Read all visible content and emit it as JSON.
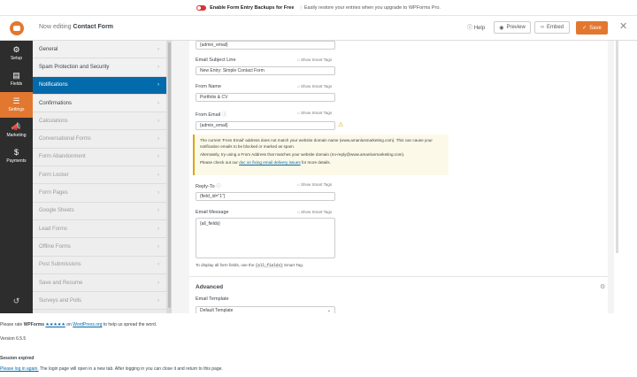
{
  "banner": {
    "label": "Enable Form Entry Backups for Free",
    "separator": "|",
    "text": "Easily restore your entries when you upgrade to WPForms Pro."
  },
  "header": {
    "editing_prefix": "Now editing",
    "form_name": "Contact Form",
    "help": "Help",
    "preview": "Preview",
    "embed": "Embed",
    "save": "Save",
    "close": "✕"
  },
  "leftnav": [
    {
      "label": "Setup",
      "icon": "⚙"
    },
    {
      "label": "Fields",
      "icon": "▤"
    },
    {
      "label": "Settings",
      "icon": "☰"
    },
    {
      "label": "Marketing",
      "icon": "📣"
    },
    {
      "label": "Payments",
      "icon": "$"
    }
  ],
  "undo_icon": "↺",
  "panel": {
    "items": [
      {
        "label": "General",
        "state": "normal"
      },
      {
        "label": "Spam Protection and Security",
        "state": "normal"
      },
      {
        "label": "Notifications",
        "state": "active"
      },
      {
        "label": "Confirmations",
        "state": "normal"
      },
      {
        "label": "Calculations",
        "state": "dim"
      },
      {
        "label": "Conversational Forms",
        "state": "dim"
      },
      {
        "label": "Form Abandonment",
        "state": "dim"
      },
      {
        "label": "Form Locker",
        "state": "dim"
      },
      {
        "label": "Form Pages",
        "state": "dim"
      },
      {
        "label": "Google Sheets",
        "state": "dim"
      },
      {
        "label": "Lead Forms",
        "state": "dim"
      },
      {
        "label": "Offline Forms",
        "state": "dim"
      },
      {
        "label": "Post Submissions",
        "state": "dim"
      },
      {
        "label": "Save and Resume",
        "state": "dim"
      },
      {
        "label": "Surveys and Polls",
        "state": "dim"
      }
    ],
    "chevron": "›"
  },
  "form": {
    "top_value": "{admin_email}",
    "subject_label": "Email Subject Line",
    "subject_value": "New Entry: Simple Contact Form",
    "from_name_label": "From Name",
    "from_name_value": "Portfolio & CV",
    "from_email_label": "From Email",
    "from_email_value": "{admin_email}",
    "smart_tags": "Show Smart Tags",
    "alert_p1": "The current 'From Email' address does not match your website domain name (www.amanlusmarketing.com). This can cause your notification emails to be blocked or marked as spam.",
    "alert_p2": "Alternately, try using a From Address that matches your website domain (no-reply@www.amanlusmarketing.com).",
    "alert_p3_pre": "Please check out our",
    "alert_p3_link": "doc on fixing email delivery issues",
    "alert_p3_post": "for more details.",
    "reply_to_label": "Reply-To",
    "reply_to_value": "{field_id=\"1\"}",
    "message_label": "Email Message",
    "message_value": "{all_fields}",
    "hint_pre": "To display all form fields, use the",
    "hint_code": "{all_fields}",
    "hint_post": "Smart Tag.",
    "advanced": "Advanced",
    "template_label": "Email Template",
    "template_value": "Default Template"
  },
  "footer": {
    "rate_pre": "Please rate",
    "rate_brand": "WPForms",
    "rate_stars": "★★★★★",
    "rate_on": "on",
    "rate_link": "WordPress.org",
    "rate_post": "to help us spread the word.",
    "version": "Version 6.5.5",
    "session_title": "Session expired",
    "session_link": "Please log in again.",
    "session_text": "The login page will open in a new tab. After logging in you can close it and return to this page."
  }
}
